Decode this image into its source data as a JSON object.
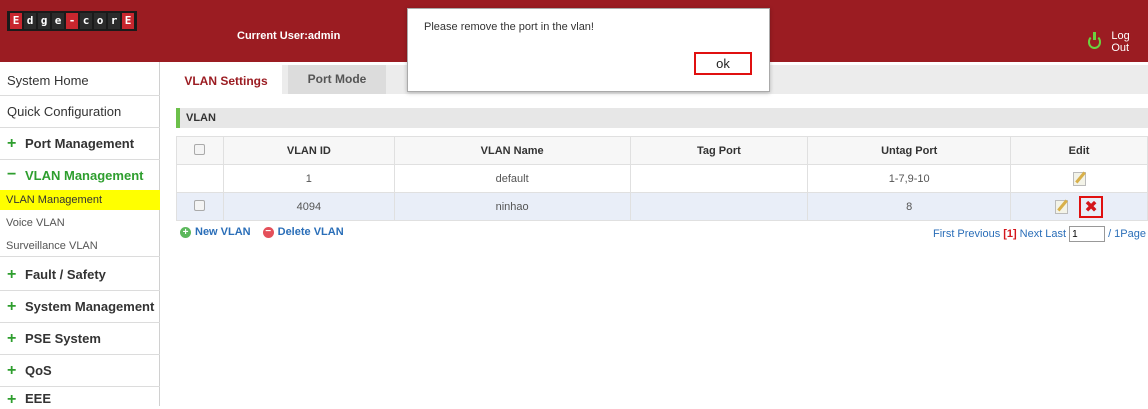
{
  "header": {
    "logo_letters": [
      "E",
      "d",
      "g",
      "e",
      "-",
      "c",
      "o",
      "r",
      "E"
    ],
    "current_user": "Current User:admin",
    "logout_label": "Log Out",
    "brand_color": "#9b1c22"
  },
  "sidebar": {
    "items": [
      {
        "label": "System Home"
      },
      {
        "label": "Quick Configuration"
      },
      {
        "label": "Port Management",
        "prefix": "+"
      },
      {
        "label": "VLAN Management",
        "prefix": "−"
      },
      {
        "label": "Fault / Safety",
        "prefix": "+"
      },
      {
        "label": "System Management",
        "prefix": "+"
      },
      {
        "label": "PSE System",
        "prefix": "+"
      },
      {
        "label": "QoS",
        "prefix": "+"
      },
      {
        "label": "EEE",
        "prefix": "+"
      }
    ],
    "vlan_sub": [
      {
        "label": "VLAN Management"
      },
      {
        "label": "Voice VLAN"
      },
      {
        "label": "Surveillance VLAN"
      }
    ]
  },
  "tabs": [
    {
      "label": "VLAN Settings"
    },
    {
      "label": "Port Mode"
    }
  ],
  "section": {
    "title": "VLAN"
  },
  "table": {
    "headers": [
      "VLAN ID",
      "VLAN Name",
      "Tag Port",
      "Untag Port",
      "Edit"
    ],
    "rows": [
      {
        "id": "1",
        "name": "default",
        "tag": "",
        "untag": "1-7,9-10"
      },
      {
        "id": "4094",
        "name": "ninhao",
        "tag": "",
        "untag": "8"
      }
    ]
  },
  "actions": {
    "new_label": "New VLAN",
    "delete_label": "Delete VLAN"
  },
  "pager": {
    "first": "First",
    "previous": "Previous",
    "current": "[1]",
    "next": "Next",
    "last": "Last",
    "page_value": "1",
    "total": "/ 1Page"
  },
  "dialog": {
    "message": "Please remove the  port in the vlan!",
    "ok_label": "ok"
  }
}
